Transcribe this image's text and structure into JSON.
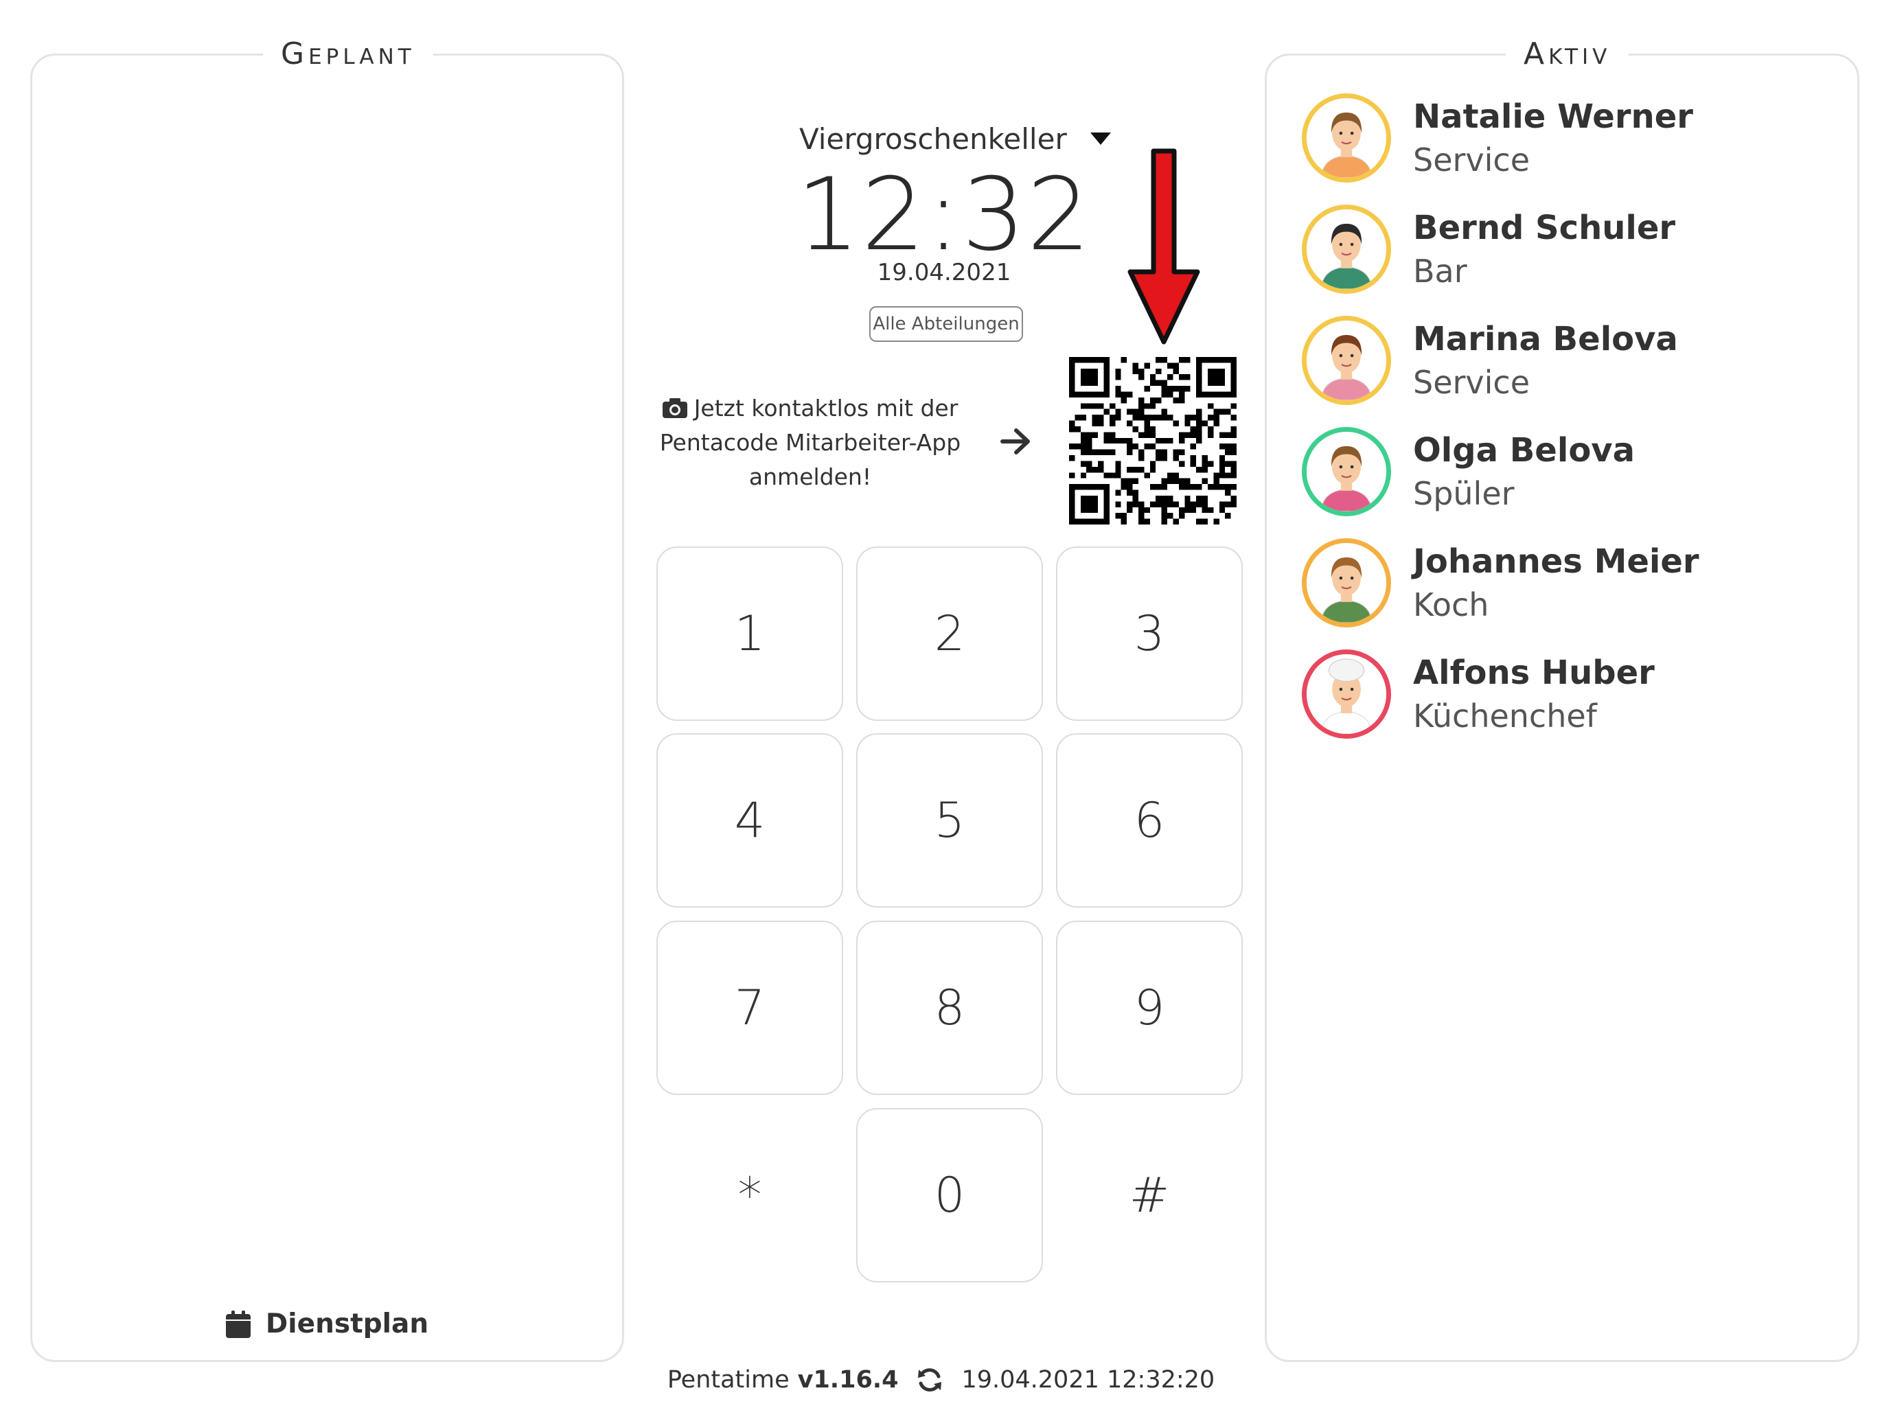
{
  "planned_panel": {
    "title": "Geplant",
    "schedule_link": "Dienstplan",
    "schedule_icon": "calendar-icon"
  },
  "active_panel": {
    "title": "Aktiv",
    "employees": [
      {
        "name": "Natalie Werner",
        "role": "Service",
        "ring_color": "#f5c84a"
      },
      {
        "name": "Bernd Schuler",
        "role": "Bar",
        "ring_color": "#f5c84a"
      },
      {
        "name": "Marina Belova",
        "role": "Service",
        "ring_color": "#f5c84a"
      },
      {
        "name": "Olga Belova",
        "role": "Spüler",
        "ring_color": "#3ecf8e"
      },
      {
        "name": "Johannes Meier",
        "role": "Koch",
        "ring_color": "#f5b041"
      },
      {
        "name": "Alfons Huber",
        "role": "Küchenchef",
        "ring_color": "#e8475f"
      }
    ]
  },
  "center": {
    "location": "Viergroschenkeller",
    "time": "12:32",
    "date": "19.04.2021",
    "department_button": "Alle Abteilungen",
    "hint_text": "Jetzt kontaktlos mit der Pentacode Mitarbeiter-App anmelden!",
    "hint_icon": "camera-icon",
    "arrow_color": "#e3161b"
  },
  "keypad": {
    "keys": [
      "1",
      "2",
      "3",
      "4",
      "5",
      "6",
      "7",
      "8",
      "9",
      "*",
      "0",
      "#"
    ]
  },
  "footer": {
    "app_name": "Pentatime",
    "version": "v1.16.4",
    "sync_icon": "sync-icon",
    "timestamp": "19.04.2021 12:32:20"
  }
}
